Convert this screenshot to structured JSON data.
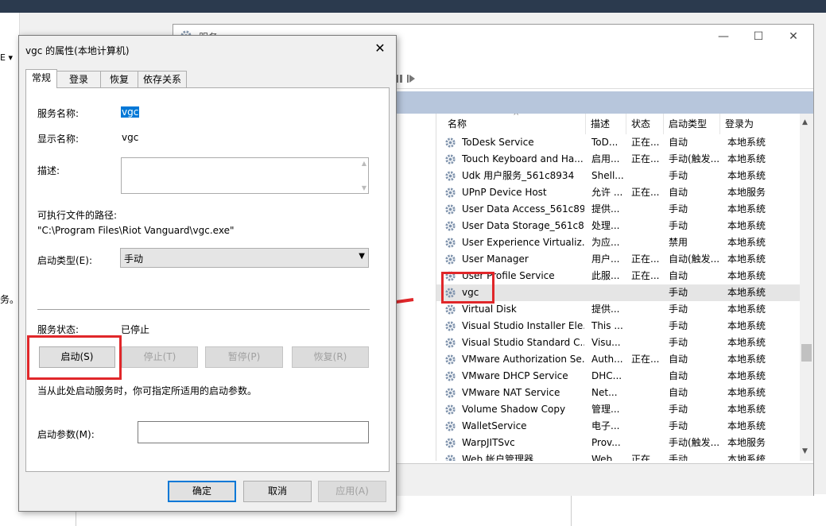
{
  "services_window": {
    "title": "服务",
    "columns": [
      "名称",
      "描述",
      "状态",
      "启动类型",
      "登录为"
    ],
    "rows": [
      {
        "name": "ToDesk Service",
        "desc": "ToD...",
        "status": "正在...",
        "startup": "自动",
        "logon": "本地系统"
      },
      {
        "name": "Touch Keyboard and Ha...",
        "desc": "启用...",
        "status": "正在...",
        "startup": "手动(触发...",
        "logon": "本地系统"
      },
      {
        "name": "Udk 用户服务_561c8934",
        "desc": "Shell...",
        "status": "",
        "startup": "手动",
        "logon": "本地系统"
      },
      {
        "name": "UPnP Device Host",
        "desc": "允许 ...",
        "status": "正在...",
        "startup": "自动",
        "logon": "本地服务"
      },
      {
        "name": "User Data Access_561c89...",
        "desc": "提供...",
        "status": "",
        "startup": "手动",
        "logon": "本地系统"
      },
      {
        "name": "User Data Storage_561c8...",
        "desc": "处理...",
        "status": "",
        "startup": "手动",
        "logon": "本地系统"
      },
      {
        "name": "User Experience Virtualiz...",
        "desc": "为应...",
        "status": "",
        "startup": "禁用",
        "logon": "本地系统"
      },
      {
        "name": "User Manager",
        "desc": "用户...",
        "status": "正在...",
        "startup": "自动(触发...",
        "logon": "本地系统"
      },
      {
        "name": "User Profile Service",
        "desc": "此服...",
        "status": "正在...",
        "startup": "自动",
        "logon": "本地系统"
      },
      {
        "name": "vgc",
        "desc": "",
        "status": "",
        "startup": "手动",
        "logon": "本地系统"
      },
      {
        "name": "Virtual Disk",
        "desc": "提供...",
        "status": "",
        "startup": "手动",
        "logon": "本地系统"
      },
      {
        "name": "Visual Studio Installer Ele...",
        "desc": "This ...",
        "status": "",
        "startup": "手动",
        "logon": "本地系统"
      },
      {
        "name": "Visual Studio Standard C...",
        "desc": "Visu...",
        "status": "",
        "startup": "手动",
        "logon": "本地系统"
      },
      {
        "name": "VMware Authorization Se...",
        "desc": "Auth...",
        "status": "正在...",
        "startup": "自动",
        "logon": "本地系统"
      },
      {
        "name": "VMware DHCP Service",
        "desc": "DHC...",
        "status": "",
        "startup": "自动",
        "logon": "本地系统"
      },
      {
        "name": "VMware NAT Service",
        "desc": "Net...",
        "status": "",
        "startup": "自动",
        "logon": "本地系统"
      },
      {
        "name": "Volume Shadow Copy",
        "desc": "管理...",
        "status": "",
        "startup": "手动",
        "logon": "本地系统"
      },
      {
        "name": "WalletService",
        "desc": "电子...",
        "status": "",
        "startup": "手动",
        "logon": "本地系统"
      },
      {
        "name": "WarpJITSvc",
        "desc": "Prov...",
        "status": "",
        "startup": "手动(触发...",
        "logon": "本地服务"
      },
      {
        "name": "Web 帐户管理器",
        "desc": "Web...",
        "status": "正在...",
        "startup": "手动",
        "logon": "本地系统"
      }
    ],
    "selected_row": "vgc"
  },
  "background": {
    "left_fragment_1": "E ▾",
    "left_fragment_2": "务。"
  },
  "dialog": {
    "title": "vgc 的属性(本地计算机)",
    "close_glyph": "✕",
    "tabs": [
      "常规",
      "登录",
      "恢复",
      "依存关系"
    ],
    "active_tab": "常规",
    "service_name_label": "服务名称:",
    "service_name_value": "vgc",
    "display_name_label": "显示名称:",
    "display_name_value": "vgc",
    "description_label": "描述:",
    "description_value": "",
    "exe_path_label": "可执行文件的路径:",
    "exe_path_value": "\"C:\\Program Files\\Riot Vanguard\\vgc.exe\"",
    "startup_type_label": "启动类型(E):",
    "startup_type_value": "手动",
    "service_status_label": "服务状态:",
    "service_status_value": "已停止",
    "btn_start": "启动(S)",
    "btn_stop": "停止(T)",
    "btn_pause": "暂停(P)",
    "btn_resume": "恢复(R)",
    "hint": "当从此处启动服务时，你可指定所适用的启动参数。",
    "start_params_label": "启动参数(M):",
    "start_params_value": "",
    "btn_ok": "确定",
    "btn_cancel": "取消",
    "btn_apply": "应用(A)"
  },
  "colors": {
    "annotation_red": "#e0272a",
    "selection_blue": "#0078d7"
  }
}
